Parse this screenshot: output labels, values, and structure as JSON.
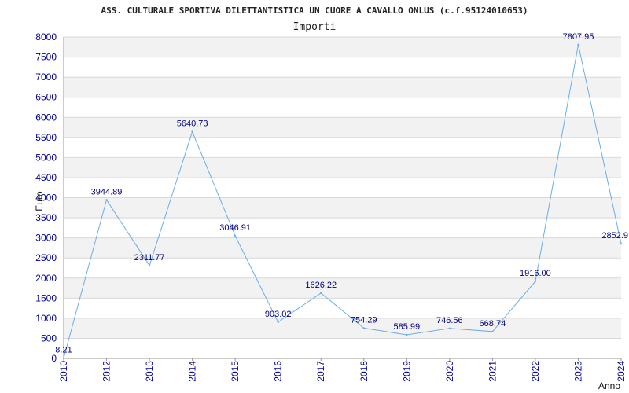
{
  "chart_data": {
    "type": "line",
    "title": "ASS. CULTURALE SPORTIVA DILETTANTISTICA UN CUORE A CAVALLO ONLUS (c.f.95124010653)",
    "subtitle": "Importi",
    "xlabel": "Anno",
    "ylabel": "Euro",
    "categories": [
      "2010",
      "2012",
      "2013",
      "2014",
      "2015",
      "2016",
      "2017",
      "2018",
      "2019",
      "2020",
      "2021",
      "2022",
      "2023",
      "2024"
    ],
    "series": [
      {
        "values": [
          8.21,
          3944.89,
          2311.77,
          5640.73,
          3046.91,
          903.02,
          1626.22,
          754.29,
          585.99,
          746.56,
          668.74,
          1916.0,
          7807.95,
          2852.9
        ]
      }
    ],
    "data_labels": [
      "8.21",
      "3944.89",
      "2311.77",
      "5640.73",
      "3046.91",
      "903.02",
      "1626.22",
      "754.29",
      "585.99",
      "746.56",
      "668.74",
      "1916.00",
      "7807.95",
      "2852.9"
    ],
    "y_ticks": [
      "0",
      "500",
      "1000",
      "1500",
      "2000",
      "2500",
      "3000",
      "3500",
      "4000",
      "4500",
      "5000",
      "5500",
      "6000",
      "6500",
      "7000",
      "7500",
      "8000"
    ],
    "ylim": [
      0,
      8000
    ],
    "grid": true,
    "colors": {
      "line": "#6aaee8",
      "band": "#f2f2f2",
      "grid": "#d8d8d8",
      "tick_text": "#000099",
      "label_text": "#000080"
    }
  }
}
